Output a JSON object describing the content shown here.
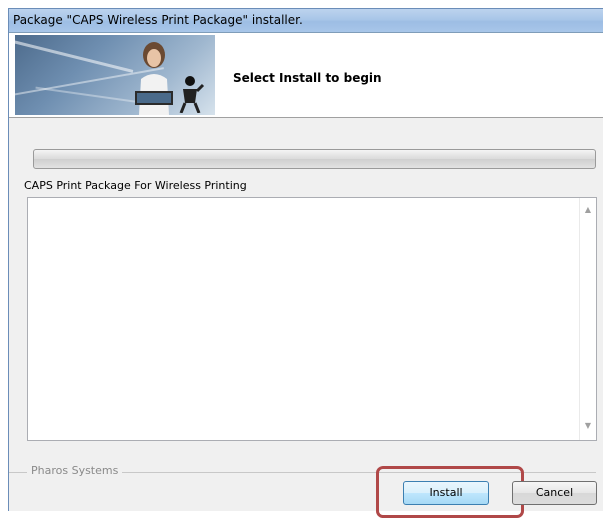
{
  "window": {
    "title": "Package \"CAPS Wireless Print Package\" installer."
  },
  "banner": {
    "heading": "Select Install to begin"
  },
  "progress": {
    "value": 0
  },
  "package": {
    "name": "CAPS Print Package For Wireless Printing",
    "details": ""
  },
  "footer": {
    "vendor": "Pharos Systems",
    "install_label": "Install",
    "cancel_label": "Cancel"
  },
  "colors": {
    "titlebar": "#a9c6e8",
    "highlight": "#b04848",
    "install_border": "#3c7fb1"
  },
  "icons": {
    "scroll_up": "triangle-up",
    "scroll_down": "triangle-down"
  }
}
